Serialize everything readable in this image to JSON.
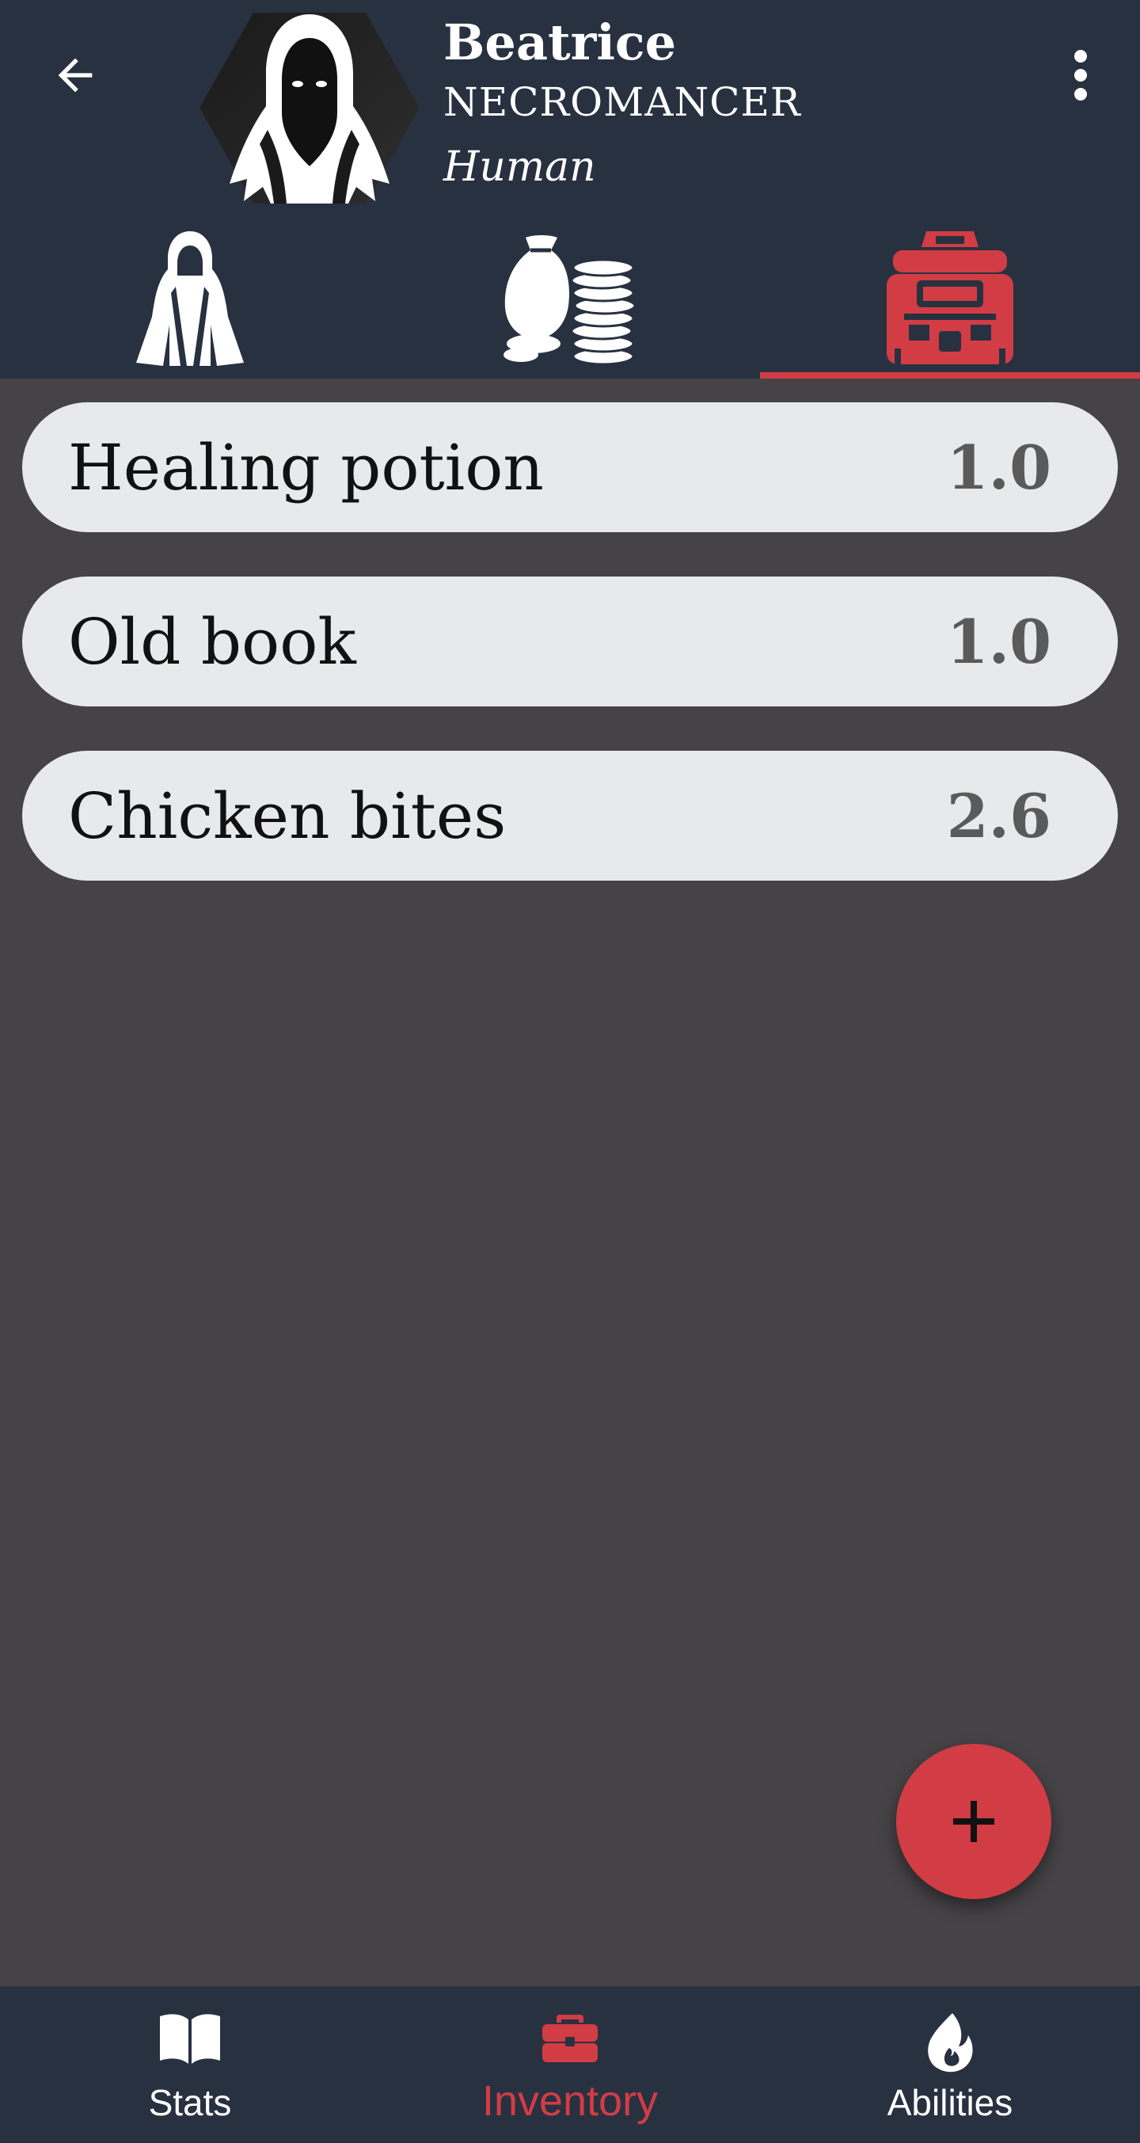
{
  "character": {
    "name": "Beatrice",
    "class": "NECROMANCER",
    "race": "Human"
  },
  "header": {
    "back_icon": "arrow-left-icon",
    "menu_icon": "more-vertical-icon"
  },
  "tabs": [
    {
      "icon": "hooded-robe-icon",
      "active": false
    },
    {
      "icon": "money-bag-coins-icon",
      "active": false
    },
    {
      "icon": "backpack-icon",
      "active": true
    }
  ],
  "inventory": [
    {
      "name": "Healing potion",
      "weight": "1.0"
    },
    {
      "name": "Old book",
      "weight": "1.0"
    },
    {
      "name": "Chicken bites",
      "weight": "2.6"
    }
  ],
  "fab": {
    "icon": "plus-icon"
  },
  "bottom_nav": [
    {
      "label": "Stats",
      "icon": "book-open-icon",
      "active": false
    },
    {
      "label": "Inventory",
      "icon": "briefcase-icon",
      "active": true
    },
    {
      "label": "Abilities",
      "icon": "flame-icon",
      "active": false
    }
  ],
  "colors": {
    "accent": "#d23c44",
    "header_bg": "#283140",
    "content_bg": "#454346",
    "item_bg": "#e8e9eb"
  }
}
